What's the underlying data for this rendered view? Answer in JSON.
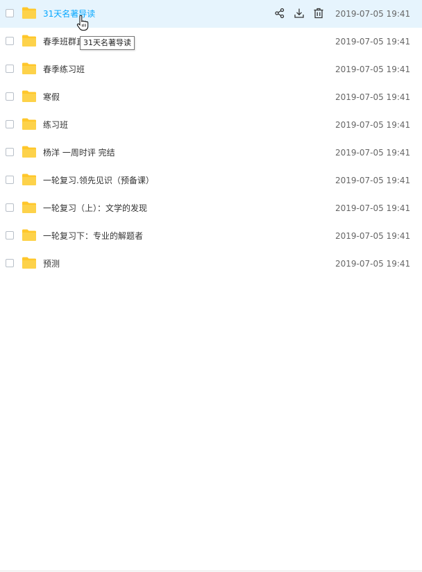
{
  "files": [
    {
      "name": "31天名著导读",
      "date": "2019-07-05 19:41"
    },
    {
      "name": "春季班群直播",
      "date": "2019-07-05 19:41"
    },
    {
      "name": "春季练习班",
      "date": "2019-07-05 19:41"
    },
    {
      "name": "寒假",
      "date": "2019-07-05 19:41"
    },
    {
      "name": "练习班",
      "date": "2019-07-05 19:41"
    },
    {
      "name": "杨洋 一周时评 完结",
      "date": "2019-07-05 19:41"
    },
    {
      "name": "一轮复习.领先见识（预备课）",
      "date": "2019-07-05 19:41"
    },
    {
      "name": "一轮复习（上）：文学的发现",
      "date": "2019-07-05 19:41"
    },
    {
      "name": "一轮复习下：专业的解题者",
      "date": "2019-07-05 19:41"
    },
    {
      "name": "预测",
      "date": "2019-07-05 19:41"
    }
  ],
  "tooltip": {
    "text": "31天名著导读"
  },
  "row_actions": [
    "share-icon",
    "download-icon",
    "delete-icon"
  ],
  "colors": {
    "hover_bg": "#e6f4fd",
    "accent": "#06a7ff",
    "folder": "#ffc72b"
  }
}
